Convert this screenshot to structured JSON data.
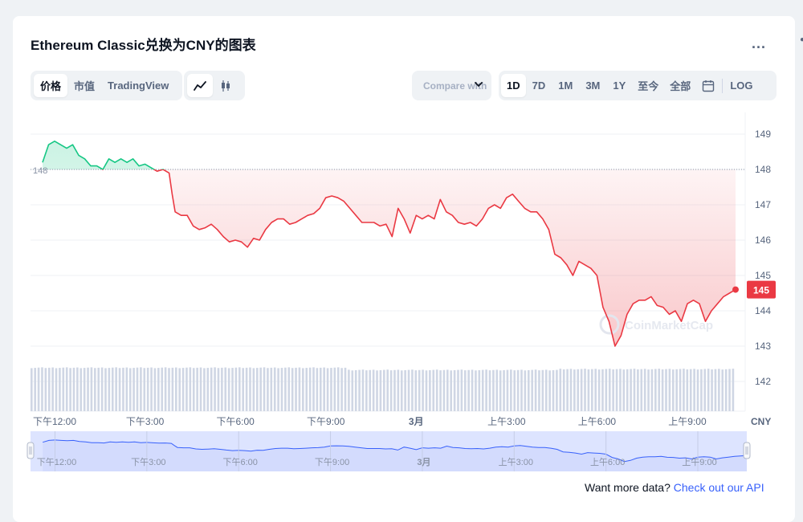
{
  "title": "Ethereum Classic兑换为CNY的图表",
  "more_label": "...",
  "view_tabs": [
    {
      "label": "价格",
      "active": true
    },
    {
      "label": "市值",
      "active": false
    },
    {
      "label": "TradingView",
      "active": false
    }
  ],
  "chart_type_icons": [
    "line-chart-icon",
    "candlestick-icon"
  ],
  "compare_label": "Compare with",
  "range_tabs": [
    {
      "label": "1D",
      "active": true
    },
    {
      "label": "7D",
      "active": false
    },
    {
      "label": "1M",
      "active": false
    },
    {
      "label": "3M",
      "active": false
    },
    {
      "label": "1Y",
      "active": false
    },
    {
      "label": "至今",
      "active": false
    },
    {
      "label": "全部",
      "active": false
    }
  ],
  "log_label": "LOG",
  "api_prompt": "Want more data?",
  "api_link": "Check out our API",
  "watermark": "CoinMarketCap",
  "colors": {
    "up": "#16c784",
    "down": "#ea3943",
    "navigator_line": "#3861fb",
    "navigator_fill": "#dde4ff",
    "volume": "#cfd6e4",
    "link": "#3861fb"
  },
  "chart_data": {
    "type": "line",
    "title": "Ethereum Classic兑换为CNY的图表",
    "currency": "CNY",
    "baseline": 148,
    "baseline_label": "148",
    "last_price_label": "145",
    "last_value": 144.6,
    "ylim": [
      141.5,
      149.3
    ],
    "yticks": [
      142,
      143,
      144,
      145,
      146,
      147,
      148,
      149
    ],
    "xlim": [
      11.2,
      34.6
    ],
    "xticks": [
      {
        "label": "下午12:00",
        "x": 12
      },
      {
        "label": "下午3:00",
        "x": 15
      },
      {
        "label": "下午6:00",
        "x": 18
      },
      {
        "label": "下午9:00",
        "x": 21
      },
      {
        "label": "3月",
        "x": 24
      },
      {
        "label": "上午3:00",
        "x": 27
      },
      {
        "label": "上午6:00",
        "x": 30
      },
      {
        "label": "上午9:00",
        "x": 33
      }
    ],
    "navigator_ticks": [
      {
        "label": "下午12:00",
        "x": 12
      },
      {
        "label": "下午3:00",
        "x": 15
      },
      {
        "label": "下午6:00",
        "x": 18
      },
      {
        "label": "下午9:00",
        "x": 21
      },
      {
        "label": "3月",
        "x": 24
      },
      {
        "label": "上午3:00",
        "x": 27
      },
      {
        "label": "上午6:00",
        "x": 30
      },
      {
        "label": "上午9:00",
        "x": 33
      }
    ],
    "grid": true,
    "series": [
      {
        "points": [
          [
            11.6,
            148.2
          ],
          [
            11.8,
            148.7
          ],
          [
            12.0,
            148.8
          ],
          [
            12.2,
            148.7
          ],
          [
            12.4,
            148.6
          ],
          [
            12.6,
            148.7
          ],
          [
            12.8,
            148.4
          ],
          [
            13.0,
            148.3
          ],
          [
            13.2,
            148.1
          ],
          [
            13.4,
            148.1
          ],
          [
            13.6,
            148.0
          ],
          [
            13.8,
            148.3
          ],
          [
            14.0,
            148.2
          ],
          [
            14.2,
            148.3
          ],
          [
            14.4,
            148.2
          ],
          [
            14.6,
            148.3
          ],
          [
            14.8,
            148.1
          ],
          [
            15.0,
            148.15
          ],
          [
            15.2,
            148.05
          ],
          [
            15.4,
            147.95
          ],
          [
            15.6,
            148.0
          ],
          [
            15.8,
            147.9
          ],
          [
            15.9,
            147.3
          ],
          [
            16.0,
            146.8
          ],
          [
            16.2,
            146.7
          ],
          [
            16.4,
            146.7
          ],
          [
            16.6,
            146.4
          ],
          [
            16.8,
            146.3
          ],
          [
            17.0,
            146.35
          ],
          [
            17.2,
            146.45
          ],
          [
            17.4,
            146.3
          ],
          [
            17.6,
            146.1
          ],
          [
            17.8,
            145.95
          ],
          [
            18.0,
            146.0
          ],
          [
            18.2,
            145.95
          ],
          [
            18.4,
            145.8
          ],
          [
            18.6,
            146.05
          ],
          [
            18.8,
            146.0
          ],
          [
            19.0,
            146.3
          ],
          [
            19.2,
            146.5
          ],
          [
            19.4,
            146.6
          ],
          [
            19.6,
            146.6
          ],
          [
            19.8,
            146.45
          ],
          [
            20.0,
            146.5
          ],
          [
            20.2,
            146.6
          ],
          [
            20.4,
            146.7
          ],
          [
            20.6,
            146.75
          ],
          [
            20.8,
            146.9
          ],
          [
            21.0,
            147.2
          ],
          [
            21.2,
            147.25
          ],
          [
            21.4,
            147.2
          ],
          [
            21.6,
            147.1
          ],
          [
            21.8,
            146.9
          ],
          [
            22.0,
            146.7
          ],
          [
            22.2,
            146.5
          ],
          [
            22.4,
            146.5
          ],
          [
            22.6,
            146.5
          ],
          [
            22.8,
            146.4
          ],
          [
            23.0,
            146.45
          ],
          [
            23.2,
            146.1
          ],
          [
            23.4,
            146.9
          ],
          [
            23.6,
            146.6
          ],
          [
            23.8,
            146.2
          ],
          [
            24.0,
            146.7
          ],
          [
            24.2,
            146.6
          ],
          [
            24.4,
            146.7
          ],
          [
            24.6,
            146.6
          ],
          [
            24.8,
            147.15
          ],
          [
            25.0,
            146.8
          ],
          [
            25.2,
            146.7
          ],
          [
            25.4,
            146.5
          ],
          [
            25.6,
            146.45
          ],
          [
            25.8,
            146.5
          ],
          [
            26.0,
            146.4
          ],
          [
            26.2,
            146.6
          ],
          [
            26.4,
            146.9
          ],
          [
            26.6,
            147.0
          ],
          [
            26.8,
            146.9
          ],
          [
            27.0,
            147.2
          ],
          [
            27.2,
            147.3
          ],
          [
            27.4,
            147.1
          ],
          [
            27.6,
            146.9
          ],
          [
            27.8,
            146.8
          ],
          [
            28.0,
            146.8
          ],
          [
            28.2,
            146.6
          ],
          [
            28.4,
            146.3
          ],
          [
            28.6,
            145.6
          ],
          [
            28.8,
            145.5
          ],
          [
            29.0,
            145.3
          ],
          [
            29.2,
            145.0
          ],
          [
            29.4,
            145.4
          ],
          [
            29.6,
            145.3
          ],
          [
            29.8,
            145.2
          ],
          [
            30.0,
            145.0
          ],
          [
            30.2,
            144.1
          ],
          [
            30.4,
            143.7
          ],
          [
            30.6,
            143.0
          ],
          [
            30.8,
            143.3
          ],
          [
            31.0,
            143.9
          ],
          [
            31.2,
            144.2
          ],
          [
            31.4,
            144.3
          ],
          [
            31.6,
            144.3
          ],
          [
            31.8,
            144.4
          ],
          [
            32.0,
            144.15
          ],
          [
            32.2,
            144.1
          ],
          [
            32.4,
            143.9
          ],
          [
            32.6,
            144.0
          ],
          [
            32.8,
            143.7
          ],
          [
            33.0,
            144.2
          ],
          [
            33.2,
            144.3
          ],
          [
            33.4,
            144.2
          ],
          [
            33.6,
            143.7
          ],
          [
            33.8,
            144.0
          ],
          [
            34.0,
            144.2
          ],
          [
            34.2,
            144.4
          ],
          [
            34.4,
            144.5
          ],
          [
            34.6,
            144.6
          ]
        ]
      }
    ],
    "volume_level": 0.92
  }
}
